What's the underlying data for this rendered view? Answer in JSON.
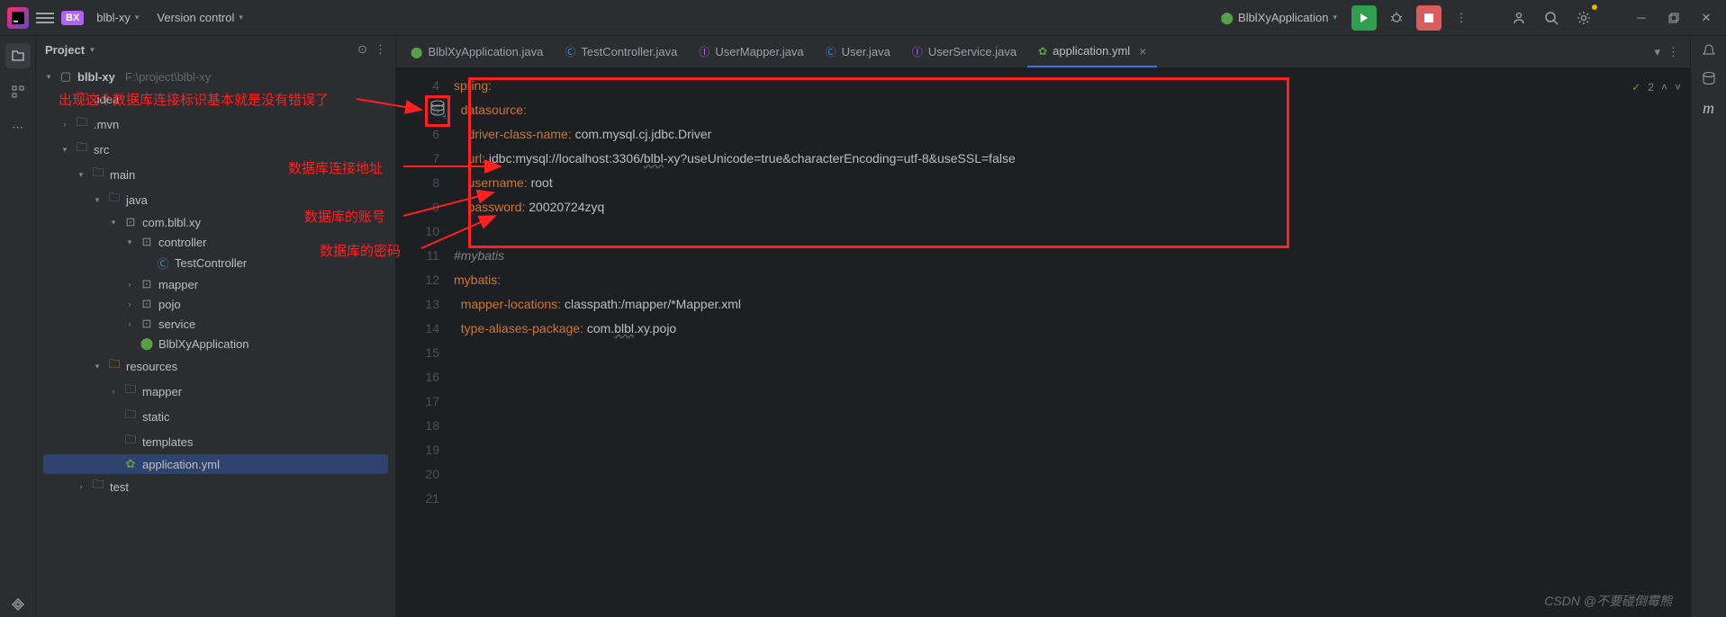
{
  "titlebar": {
    "project_badge": "BX",
    "project_name": "blbl-xy",
    "vcs_label": "Version control",
    "run_config": "BlblXyApplication"
  },
  "project_panel": {
    "title": "Project",
    "tree": {
      "root": "blbl-xy",
      "root_path": "F:\\project\\blbl-xy",
      "idea": ".idea",
      "mvn": ".mvn",
      "src": "src",
      "main": "main",
      "java": "java",
      "pkg": "com.blbl.xy",
      "controller": "controller",
      "test_controller": "TestController",
      "mapper": "mapper",
      "pojo": "pojo",
      "service": "service",
      "app_class": "BlblXyApplication",
      "resources": "resources",
      "res_mapper": "mapper",
      "static": "static",
      "templates": "templates",
      "app_yml": "application.yml",
      "test": "test"
    }
  },
  "tabs": {
    "t0": "BlblXyApplication.java",
    "t1": "TestController.java",
    "t2": "UserMapper.java",
    "t3": "User.java",
    "t4": "UserService.java",
    "t5": "application.yml"
  },
  "gutter": {
    "l4": "4",
    "l5": "5",
    "l6": "6",
    "l7": "7",
    "l8": "8",
    "l9": "9",
    "l10": "10",
    "l11": "11",
    "l12": "12",
    "l13": "13",
    "l14": "14",
    "l15": "15",
    "l16": "16",
    "l17": "17",
    "l18": "18",
    "l19": "19",
    "l20": "20",
    "l21": "21"
  },
  "code": {
    "spring": "spring",
    "datasource": "datasource",
    "driver_key": "driver-class-name",
    "driver_val": "com.mysql.cj.jdbc.Driver",
    "url_key": "url",
    "url_val": "jdbc:mysql://localhost:3306/blbl-xy?useUnicode=true&characterEncoding=utf-8&useSSL=false",
    "url_underline": "blbl",
    "username_key": "username",
    "username_val": "root",
    "password_key": "password",
    "password_val": "20020724zyq",
    "mybatis_comment": "#mybatis",
    "mybatis": "mybatis",
    "mapper_loc_key": "mapper-locations",
    "mapper_loc_val": "classpath:/mapper/*Mapper.xml",
    "alias_key": "type-aliases-package",
    "alias_val_pre": "com.",
    "alias_val_mid": "blbl",
    "alias_val_post": ".xy.pojo"
  },
  "annotations": {
    "a1": "出现这个数据库连接标识基本就是没有错误了",
    "a2": "数据库连接地址",
    "a3": "数据库的账号",
    "a4": "数据库的密码"
  },
  "status": {
    "problems": "2"
  },
  "watermark": "CSDN @不要碰倒霉熊"
}
